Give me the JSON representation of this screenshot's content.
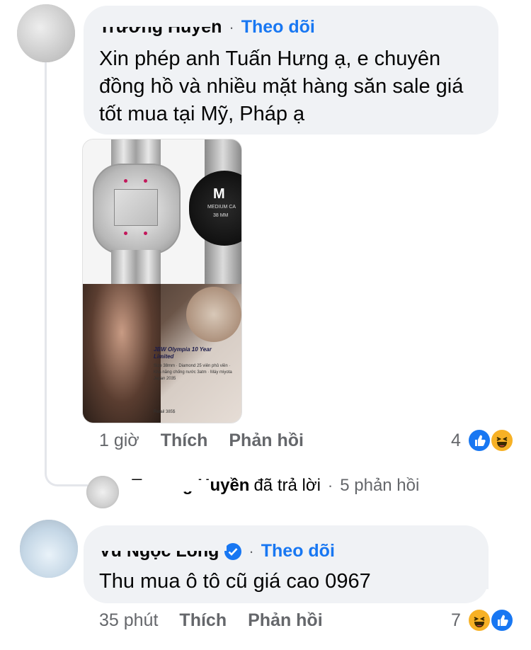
{
  "comment1": {
    "author": "Trương Huyền",
    "follow_label": "Theo dõi",
    "dot": "·",
    "text_lines": [
      "Xin phép anh Tuấn Hưng ạ, e chuyên",
      "đồng hồ và nhiều mặt hàng săn sale giá",
      "tốt mua tại Mỹ, Pháp ạ"
    ],
    "photo": {
      "watch_label_line1": "M",
      "watch_label_line2": "MEDIUM CA",
      "watch_label_line3": "38 MM",
      "promo_title": "JBW Olympia 10 Year Limited",
      "promo_text": "Size 38mm · Diamond 25 viên phủ viền · Khả năng chống nước 3atm · Máy miyota Japan 2035",
      "promo_price": "Retail 385$"
    },
    "time": "1 giờ",
    "like_label": "Thích",
    "reply_label": "Phản hồi",
    "reaction_count": "4",
    "reaction_icons": [
      "like-icon",
      "haha-icon"
    ]
  },
  "reply_summary": {
    "author": "Trương Huyền",
    "action_text": "đã trả lời",
    "dot": "·",
    "replies_label": "5 phản hồi"
  },
  "comment2": {
    "author": "Vũ Ngọc Long",
    "verified_icon": "verified-badge-icon",
    "follow_label": "Theo dõi",
    "dot": "·",
    "text": "Thu mua ô tô cũ giá cao 0967",
    "time": "35 phút",
    "like_label": "Thích",
    "reply_label": "Phản hồi",
    "reaction_count": "7",
    "reaction_icons": [
      "haha-icon",
      "like-icon"
    ]
  },
  "colors": {
    "bubble": "#f0f2f5",
    "follow": "#1877f2",
    "meta": "#65676b",
    "like": "#1877f2",
    "haha": "#f7b125"
  }
}
